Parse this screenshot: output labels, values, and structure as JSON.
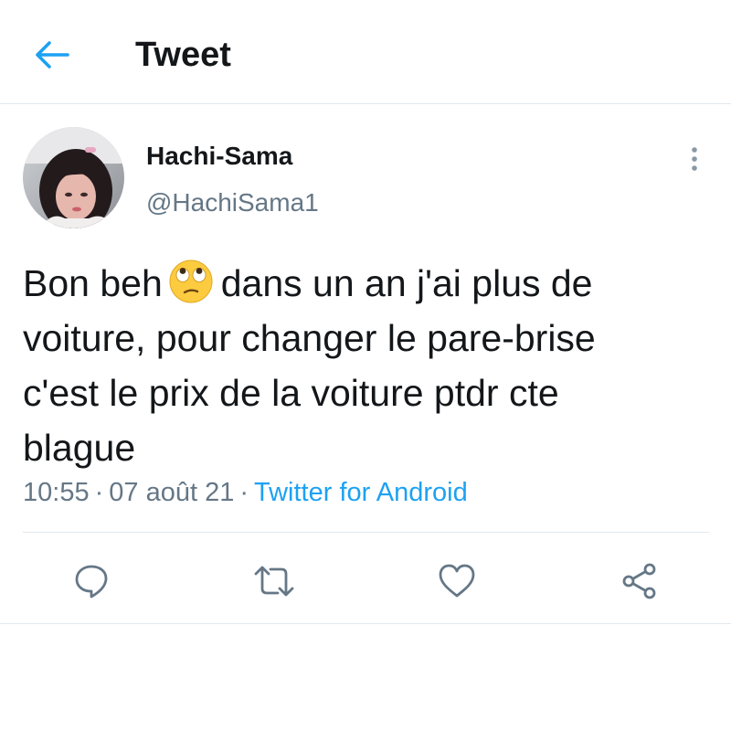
{
  "header": {
    "title": "Tweet",
    "back_icon": "arrow-left-icon"
  },
  "author": {
    "display_name": "Hachi-Sama",
    "handle": "@HachiSama1",
    "avatar_icon": "profile-photo"
  },
  "tweet": {
    "text_lines": [
      {
        "before_emoji": "Bon beh",
        "emoji": "face-with-rolling-eyes",
        "after_emoji": "dans un an j'ai plus de"
      },
      {
        "text": "voiture, pour changer le pare-brise"
      },
      {
        "text": "c'est le prix de la voiture ptdr cte"
      },
      {
        "text": "blague"
      }
    ],
    "time": "10:55",
    "separator": "·",
    "date": "07 août 21",
    "source": "Twitter for Android"
  },
  "actions": [
    {
      "name": "reply",
      "icon": "reply-icon"
    },
    {
      "name": "retweet",
      "icon": "retweet-icon"
    },
    {
      "name": "like",
      "icon": "heart-icon"
    },
    {
      "name": "share",
      "icon": "share-icon"
    }
  ],
  "colors": {
    "accent": "#1da1f2",
    "text_primary": "#14171a",
    "text_secondary": "#657786",
    "divider": "#e1e8ed"
  }
}
